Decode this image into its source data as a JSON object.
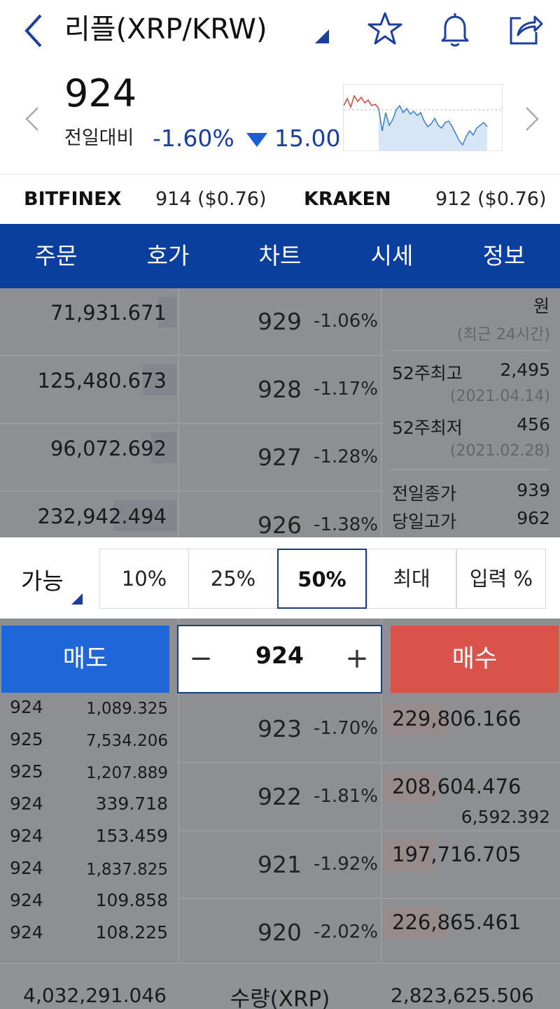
{
  "header": {
    "title": "리플(XRP/KRW)",
    "icons": [
      "back-icon",
      "star-icon",
      "bell-icon",
      "share-icon"
    ]
  },
  "price": {
    "current": "924",
    "change_label": "전일대비",
    "change_rate": "-1.60%",
    "change_amount": "15.00",
    "down_color": "#1b3fa0"
  },
  "exchanges": [
    {
      "name": "BITFINEX",
      "value": "914 ($0.76)"
    },
    {
      "name": "KRAKEN",
      "value": "912 ($0.76)"
    }
  ],
  "tabs": [
    "주문",
    "호가",
    "차트",
    "시세",
    "정보"
  ],
  "asks": [
    {
      "volume": "71,931.671",
      "price": "929",
      "rate": "-1.06%",
      "bar": 0.1
    },
    {
      "volume": "125,480.673",
      "price": "928",
      "rate": "-1.17%",
      "bar": 0.2
    },
    {
      "volume": "96,072.692",
      "price": "927",
      "rate": "-1.28%",
      "bar": 0.15
    },
    {
      "volume": "232,942.494",
      "price": "926",
      "rate": "-1.38%",
      "bar": 0.35
    }
  ],
  "info": {
    "unit": "원",
    "period": "(최근 24시간)",
    "high52_label": "52주최고",
    "high52_value": "2,495",
    "high52_date": "(2021.04.14)",
    "low52_label": "52주최저",
    "low52_value": "456",
    "low52_date": "(2021.02.28)",
    "prev_close_label": "전일종가",
    "prev_close_value": "939",
    "day_high_label": "당일고가",
    "day_high_value": "962"
  },
  "percent_selector": {
    "label": "가능",
    "options": [
      "10%",
      "25%",
      "50%",
      "최대",
      "입력 %"
    ],
    "selected": "50%"
  },
  "trade": {
    "sell_label": "매도",
    "buy_label": "매수",
    "order_price": "924",
    "minus": "−",
    "plus": "+"
  },
  "recent_trades": [
    {
      "price": "924",
      "qty": "1,089.325"
    },
    {
      "price": "925",
      "qty": "7,534.206"
    },
    {
      "price": "925",
      "qty": "1,207.889"
    },
    {
      "price": "924",
      "qty": "339.718"
    },
    {
      "price": "924",
      "qty": "153.459"
    },
    {
      "price": "924",
      "qty": "1,837.825"
    },
    {
      "price": "924",
      "qty": "109.858"
    },
    {
      "price": "924",
      "qty": "108.225"
    }
  ],
  "bids": [
    {
      "volume": "229,806.166",
      "price": "923",
      "rate": "-1.70%",
      "bar": 0.35
    },
    {
      "volume": "208,604.476",
      "price": "922",
      "rate": "-1.81%",
      "bar": 0.3
    },
    {
      "volume": "197,716.705",
      "price": "921",
      "rate": "-1.92%",
      "bar": 0.28
    },
    {
      "volume": "226,865.461",
      "price": "920",
      "rate": "-2.02%",
      "bar": 0.34
    }
  ],
  "bid_extra": "6,592.392",
  "footer": {
    "ask_total": "4,032,291.046",
    "label": "수량(XRP)",
    "bid_total": "2,823,625.506"
  }
}
